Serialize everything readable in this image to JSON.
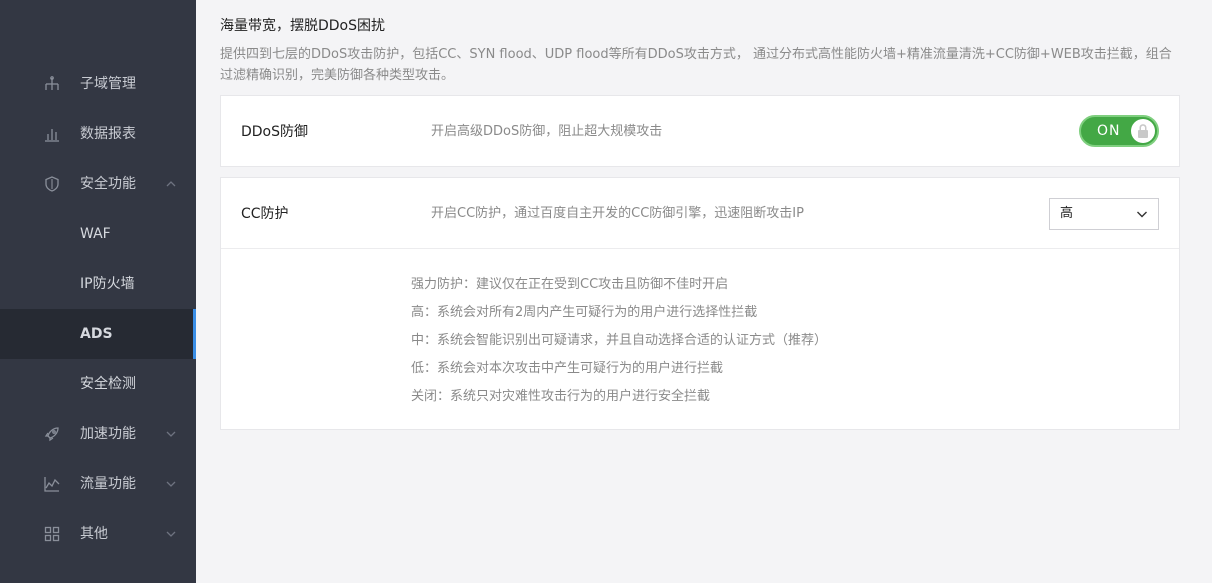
{
  "sidebar": {
    "items": [
      {
        "label": "子域管理",
        "icon": "sitemap-icon"
      },
      {
        "label": "数据报表",
        "icon": "bar-chart-icon"
      },
      {
        "label": "安全功能",
        "icon": "shield-icon",
        "expanded": true
      },
      {
        "label": "WAF"
      },
      {
        "label": "IP防火墙"
      },
      {
        "label": "ADS",
        "active": true
      },
      {
        "label": "安全检测"
      },
      {
        "label": "加速功能",
        "icon": "rocket-icon"
      },
      {
        "label": "流量功能",
        "icon": "area-chart-icon"
      },
      {
        "label": "其他",
        "icon": "grid-icon"
      }
    ]
  },
  "main": {
    "title": "海量带宽，摆脱DDoS困扰",
    "description": "提供四到七层的DDoS攻击防护，包括CC、SYN flood、UDP flood等所有DDoS攻击方式， 通过分布式高性能防火墙+精准流量清洗+CC防御+WEB攻击拦截，组合过滤精确识别，完美防御各种类型攻击。",
    "ddos": {
      "name": "DDoS防御",
      "description": "开启高级DDoS防御，阻止超大规模攻击",
      "toggle_label": "ON",
      "enabled": true
    },
    "cc": {
      "name": "CC防护",
      "description": "开启CC防护，通过百度自主开发的CC防御引擎，迅速阻断攻击IP",
      "level": "高",
      "hints": [
        "强力防护：建议仅在正在受到CC攻击且防御不佳时开启",
        "高：系统会对所有2周内产生可疑行为的用户进行选择性拦截",
        "中：系统会智能识别出可疑请求，并且自动选择合适的认证方式（推荐）",
        "低：系统会对本次攻击中产生可疑行为的用户进行拦截",
        "关闭：系统只对灾难性攻击行为的用户进行安全拦截"
      ]
    }
  },
  "colors": {
    "sidebar_bg": "#333743",
    "active_item_bg": "#262a33",
    "active_indicator": "#3a8ee6",
    "toggle_on": "#43a845"
  }
}
